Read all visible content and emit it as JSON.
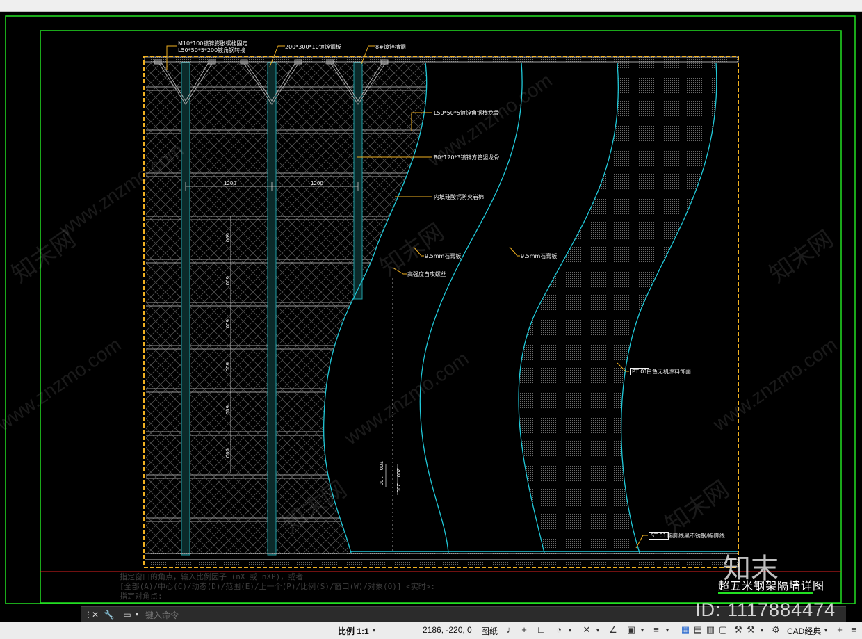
{
  "drawing": {
    "annotations": {
      "top_left_1": "M10*100镀锌膨胀螺栓固定",
      "top_left_2": "L50*50*5*200镀角钢转接",
      "top_mid": "200*300*10镀锌钢板",
      "top_right": "8#镀锌槽钢",
      "keel_1": "L50*50*5镀锌角钢横龙骨",
      "keel_2": "80*120*3镀锌方管竖龙骨",
      "fire_board": "内填硅酸钙防火岩棉",
      "gypsum_1": "9.5mm石膏板",
      "gypsum_2": "9.5mm石膏板",
      "bolt_note": "高强度自攻螺丝",
      "wall_finish_tag": "PT 01",
      "wall_finish": "白色无机涂料饰面",
      "base_tag": "ST 01",
      "base_note": "踢脚线黑不锈钢/踢脚线"
    },
    "dims": {
      "h1": "1200",
      "h2": "1200",
      "v": [
        "600",
        "600",
        "600",
        "600",
        "600",
        "600"
      ],
      "small": [
        "200",
        "100",
        "200",
        "200"
      ]
    },
    "title": "超五米钢架隔墙详图"
  },
  "watermarks": {
    "site": "www.znzmo.com",
    "cn": "知末网"
  },
  "brand": {
    "logo": "知末",
    "id": "ID: 1117884474"
  },
  "command": {
    "history": [
      "指定窗口的角点，输入比例因子 (nX 或 nXP)，或者",
      "[全部(A)/中心(C)/动态(D)/范围(E)/上一个(P)/比例(S)/窗口(W)/对象(O)] <实时>:",
      "指定对角点:"
    ],
    "placeholder": "键入命令"
  },
  "status": {
    "scale": "比例 1:1",
    "coords": "2186, -220, 0",
    "mode": "图纸",
    "workspace": "CAD经典"
  },
  "colors": {
    "border_green": "#22e022",
    "frame_orange": "#f0b020",
    "cyan": "#20c8d8",
    "red_line": "#e02020"
  }
}
